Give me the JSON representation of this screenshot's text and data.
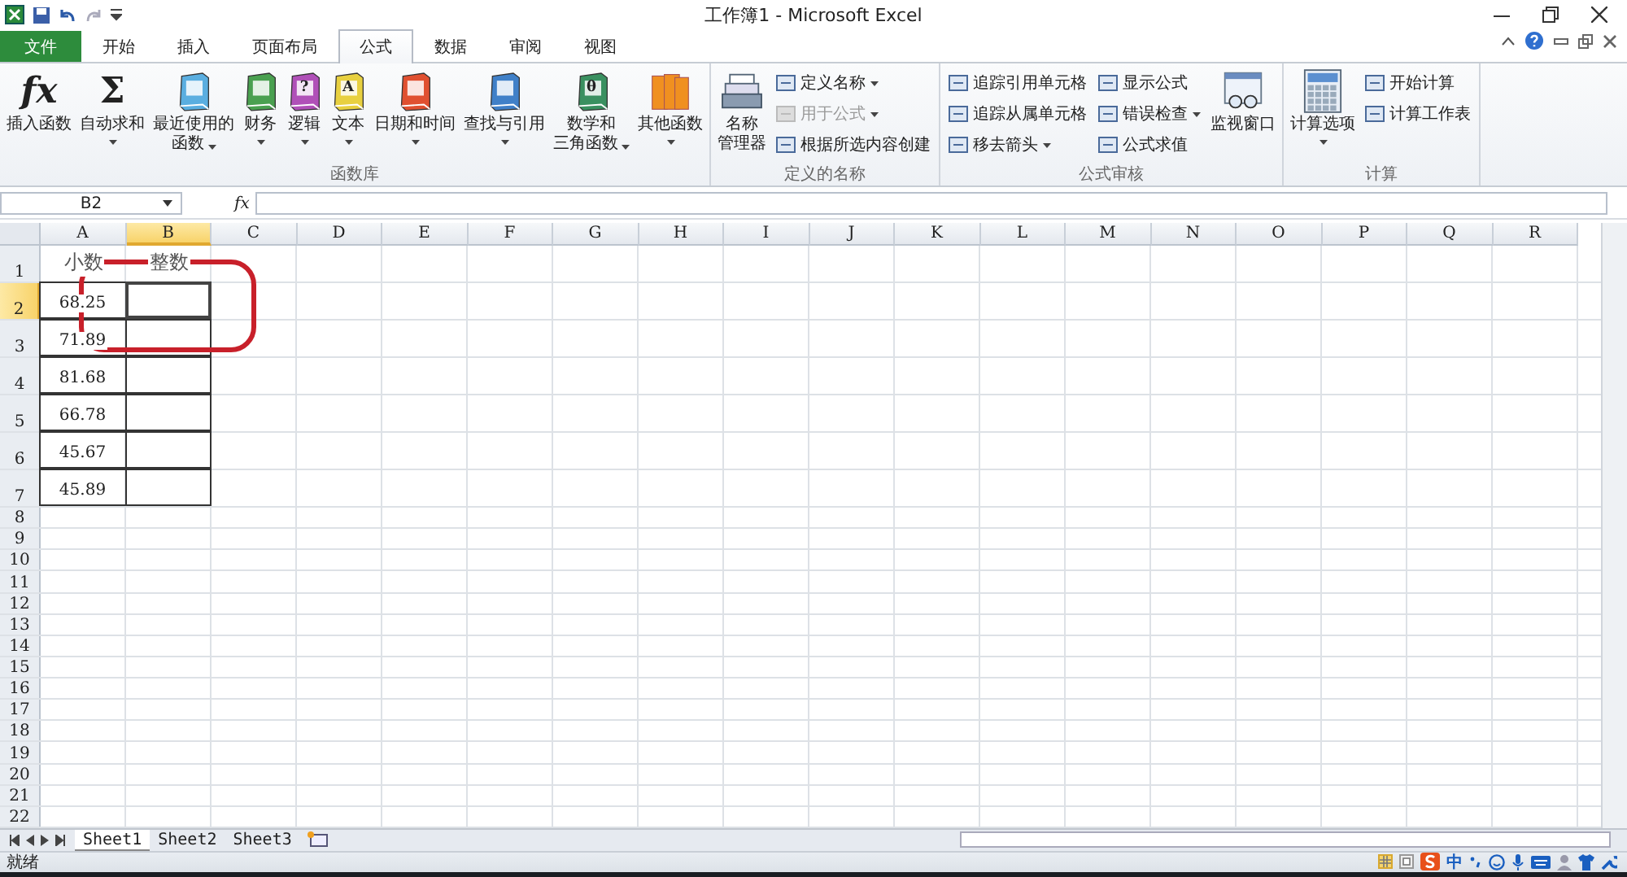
{
  "window": {
    "title": "工作簿1 - Microsoft Excel"
  },
  "tabs": [
    {
      "label": "文件",
      "kind": "file",
      "selected": false
    },
    {
      "label": "开始",
      "kind": "tab",
      "selected": false
    },
    {
      "label": "插入",
      "kind": "tab",
      "selected": false
    },
    {
      "label": "页面布局",
      "kind": "tab",
      "selected": false
    },
    {
      "label": "公式",
      "kind": "tab",
      "selected": true
    },
    {
      "label": "数据",
      "kind": "tab",
      "selected": false
    },
    {
      "label": "审阅",
      "kind": "tab",
      "selected": false
    },
    {
      "label": "视图",
      "kind": "tab",
      "selected": false
    }
  ],
  "ribbon": [
    {
      "title": "函数库",
      "items": [
        {
          "kind": "function",
          "glyph": "fx",
          "lines": [
            "插入函数"
          ],
          "dropdown": false
        },
        {
          "kind": "sum",
          "glyph": "Σ",
          "lines": [
            "自动求和"
          ],
          "dropdown": true
        },
        {
          "kind": "book",
          "color": "#5aaee0",
          "lines": [
            "最近使用的",
            "函数"
          ],
          "dropdown": true
        },
        {
          "kind": "book",
          "color": "#4aa050",
          "lines": [
            "财务"
          ],
          "dropdown": true
        },
        {
          "kind": "book",
          "color": "#b050b8",
          "glyph": "?",
          "lines": [
            "逻辑"
          ],
          "dropdown": true
        },
        {
          "kind": "book",
          "color": "#e8d040",
          "glyph": "A",
          "lines": [
            "文本"
          ],
          "dropdown": true
        },
        {
          "kind": "book",
          "color": "#e05030",
          "lines": [
            "日期和时间"
          ],
          "dropdown": true
        },
        {
          "kind": "book",
          "color": "#4080c8",
          "lines": [
            "查找与引用"
          ],
          "dropdown": true
        },
        {
          "kind": "book",
          "color": "#3a9060",
          "glyph": "θ",
          "lines": [
            "数学和",
            "三角函数"
          ],
          "dropdown": true
        },
        {
          "kind": "shelf",
          "color": "#f09020",
          "lines": [
            "其他函数"
          ],
          "dropdown": true
        }
      ]
    },
    {
      "title": "定义的名称",
      "items": [
        {
          "kind": "cards",
          "lines": [
            "名称",
            "管理器"
          ],
          "dropdown": false
        },
        {
          "kind": "stack",
          "items": [
            {
              "label": "定义名称",
              "dropdown": true,
              "disabled": false
            },
            {
              "label": "用于公式",
              "dropdown": true,
              "disabled": true
            },
            {
              "label": "根据所选内容创建",
              "dropdown": false,
              "disabled": false
            }
          ]
        }
      ]
    },
    {
      "title": "公式审核",
      "items": [
        {
          "kind": "stack",
          "items": [
            {
              "label": "追踪引用单元格",
              "dropdown": false,
              "disabled": false
            },
            {
              "label": "追踪从属单元格",
              "dropdown": false,
              "disabled": false
            },
            {
              "label": "移去箭头",
              "dropdown": true,
              "disabled": false
            }
          ]
        },
        {
          "kind": "stack",
          "items": [
            {
              "label": "显示公式",
              "dropdown": false,
              "disabled": false
            },
            {
              "label": "错误检查",
              "dropdown": true,
              "disabled": false
            },
            {
              "label": "公式求值",
              "dropdown": false,
              "disabled": false
            }
          ]
        },
        {
          "kind": "watch",
          "lines": [
            "监视窗口"
          ],
          "dropdown": false
        }
      ]
    },
    {
      "title": "计算",
      "items": [
        {
          "kind": "calculator",
          "lines": [
            "计算选项"
          ],
          "dropdown": true
        },
        {
          "kind": "stack",
          "items": [
            {
              "label": "开始计算",
              "dropdown": false,
              "disabled": false
            },
            {
              "label": "计算工作表",
              "dropdown": false,
              "disabled": false
            }
          ]
        }
      ]
    }
  ],
  "formula_bar": {
    "name_box": "B2",
    "fx_label": "fx"
  },
  "columns": [
    {
      "label": "A",
      "selected": false
    },
    {
      "label": "B",
      "selected": true
    },
    {
      "label": "C",
      "selected": false
    },
    {
      "label": "D",
      "selected": false
    },
    {
      "label": "E",
      "selected": false
    },
    {
      "label": "F",
      "selected": false
    },
    {
      "label": "G",
      "selected": false
    },
    {
      "label": "H",
      "selected": false
    },
    {
      "label": "I",
      "selected": false
    },
    {
      "label": "J",
      "selected": false
    },
    {
      "label": "K",
      "selected": false
    },
    {
      "label": "L",
      "selected": false
    },
    {
      "label": "M",
      "selected": false
    },
    {
      "label": "N",
      "selected": false
    },
    {
      "label": "O",
      "selected": false
    },
    {
      "label": "P",
      "selected": false
    },
    {
      "label": "Q",
      "selected": false
    },
    {
      "label": "R",
      "selected": false
    }
  ],
  "rows": [
    {
      "header": "1",
      "selected": false,
      "tall": true,
      "cells": [
        {
          "text": "小数",
          "kind": "heading",
          "bordered": false,
          "selected": false
        },
        {
          "text": "整数",
          "kind": "heading",
          "bordered": false,
          "selected": false
        }
      ]
    },
    {
      "header": "2",
      "selected": true,
      "tall": true,
      "cells": [
        {
          "text": "68.25",
          "kind": "number",
          "bordered": true,
          "selected": false
        },
        {
          "kind": "number",
          "bordered": true,
          "selected": true
        }
      ]
    },
    {
      "header": "3",
      "selected": false,
      "tall": true,
      "cells": [
        {
          "text": "71.89",
          "kind": "number",
          "bordered": true,
          "selected": false
        },
        {
          "kind": "number",
          "bordered": true,
          "selected": false
        }
      ]
    },
    {
      "header": "4",
      "selected": false,
      "tall": true,
      "cells": [
        {
          "text": "81.68",
          "kind": "number",
          "bordered": true,
          "selected": false
        },
        {
          "kind": "number",
          "bordered": true,
          "selected": false
        }
      ]
    },
    {
      "header": "5",
      "selected": false,
      "tall": true,
      "cells": [
        {
          "text": "66.78",
          "kind": "number",
          "bordered": true,
          "selected": false
        },
        {
          "kind": "number",
          "bordered": true,
          "selected": false
        }
      ]
    },
    {
      "header": "6",
      "selected": false,
      "tall": true,
      "cells": [
        {
          "text": "45.67",
          "kind": "number",
          "bordered": true,
          "selected": false
        },
        {
          "kind": "number",
          "bordered": true,
          "selected": false
        }
      ]
    },
    {
      "header": "7",
      "selected": false,
      "tall": true,
      "cells": [
        {
          "text": "45.89",
          "kind": "number",
          "bordered": true,
          "selected": false
        },
        {
          "kind": "number",
          "bordered": true,
          "selected": false
        }
      ]
    },
    {
      "header": "8",
      "selected": false,
      "tall": false,
      "cells": []
    },
    {
      "header": "9",
      "selected": false,
      "tall": false,
      "cells": []
    },
    {
      "header": "10",
      "selected": false,
      "tall": false,
      "cells": []
    },
    {
      "header": "11",
      "selected": false,
      "tall": false,
      "cells": []
    },
    {
      "header": "12",
      "selected": false,
      "tall": false,
      "cells": []
    },
    {
      "header": "13",
      "selected": false,
      "tall": false,
      "cells": []
    },
    {
      "header": "14",
      "selected": false,
      "tall": false,
      "cells": []
    },
    {
      "header": "15",
      "selected": false,
      "tall": false,
      "cells": []
    },
    {
      "header": "16",
      "selected": false,
      "tall": false,
      "cells": []
    },
    {
      "header": "17",
      "selected": false,
      "tall": false,
      "cells": []
    },
    {
      "header": "18",
      "selected": false,
      "tall": false,
      "cells": []
    },
    {
      "header": "19",
      "selected": false,
      "tall": false,
      "cells": []
    },
    {
      "header": "20",
      "selected": false,
      "tall": false,
      "cells": []
    },
    {
      "header": "21",
      "selected": false,
      "tall": false,
      "cells": []
    },
    {
      "header": "22",
      "selected": false,
      "tall": false,
      "cells": []
    }
  ],
  "sheets": [
    {
      "label": "Sheet1",
      "selected": true
    },
    {
      "label": "Sheet2",
      "selected": false
    },
    {
      "label": "Sheet3",
      "selected": false
    }
  ],
  "status_bar": {
    "text": "就绪",
    "ime_label": "中",
    "views": [
      {
        "kind": "normal",
        "selected": true
      },
      {
        "kind": "layout",
        "selected": false
      }
    ]
  }
}
